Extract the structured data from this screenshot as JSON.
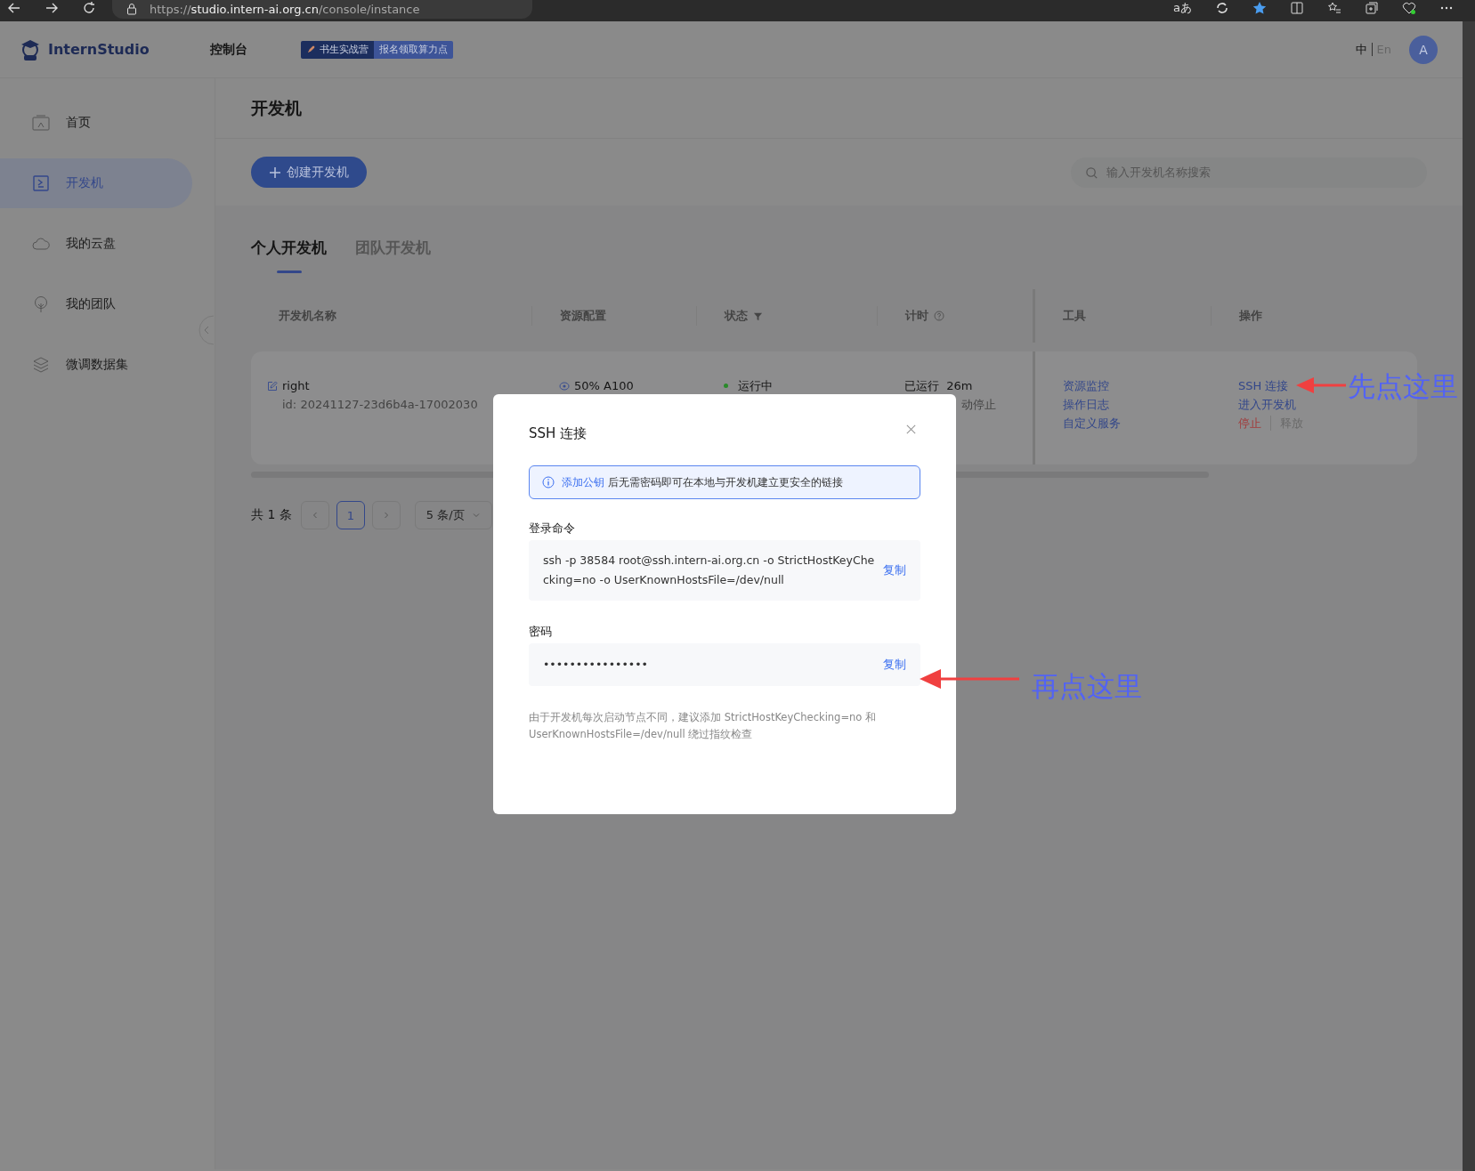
{
  "browser": {
    "url": {
      "scheme": "https://",
      "host": "studio.intern-ai.org.cn",
      "path": "/console/instance"
    },
    "read_aloud": "aあ"
  },
  "header": {
    "logo": "InternStudio",
    "console": "控制台",
    "banner": {
      "tag": "书生实战营",
      "text": "报名领取算力点"
    },
    "languages": [
      {
        "label": "中",
        "selected": true
      },
      {
        "label": "En",
        "selected": false
      }
    ],
    "avatar": "A"
  },
  "sidebar": {
    "items": [
      {
        "label": "首页",
        "selected": false
      },
      {
        "label": "开发机",
        "selected": true
      },
      {
        "label": "我的云盘",
        "selected": false
      },
      {
        "label": "我的团队",
        "selected": false
      },
      {
        "label": "微调数据集",
        "selected": false
      }
    ]
  },
  "page": {
    "title": "开发机",
    "create_button": "创建开发机",
    "search": {
      "placeholder": "输入开发机名称搜索"
    },
    "tabs": [
      {
        "label": "个人开发机",
        "selected": true
      },
      {
        "label": "团队开发机",
        "selected": false
      }
    ],
    "table": {
      "columns": [
        {
          "label": "开发机名称",
          "kind": "plain"
        },
        {
          "label": "资源配置",
          "kind": "plain"
        },
        {
          "label": "状态",
          "kind": "filter"
        },
        {
          "label": "计时",
          "kind": "help"
        },
        {
          "label": "工具",
          "kind": "plain"
        },
        {
          "label": "操作",
          "kind": "plain"
        }
      ],
      "rows": [
        {
          "name": "right",
          "id": "id: 20241127-23d6b4a-17002030",
          "resource": "50% A100",
          "status": "运行中",
          "timer": "已运行  26m",
          "timer_note": "动停止",
          "tools": [
            "资源监控",
            "操作日志",
            "自定义服务"
          ],
          "action_lines": [
            [
              {
                "label": "SSH 连接",
                "kind": "link"
              }
            ],
            [
              {
                "label": "进入开发机",
                "kind": "link"
              }
            ],
            [
              {
                "label": "停止",
                "kind": "danger"
              },
              {
                "label": "释放",
                "kind": "disabled"
              }
            ]
          ]
        }
      ]
    },
    "pagination": {
      "total": "共 1 条",
      "pages": [
        {
          "label": "1",
          "selected": true
        }
      ],
      "page_size": "5 条/页"
    }
  },
  "modal": {
    "title": "SSH 连接",
    "alert": {
      "link": "添加公钥",
      "text": "后无需密码即可在本地与开发机建立更安全的链接"
    },
    "fields": [
      {
        "label": "登录命令",
        "value": "ssh -p 38584 root@ssh.intern-ai.org.cn -o StrictHostKeyChecking=no -o UserKnownHostsFile=/dev/null",
        "copy": "复制"
      },
      {
        "label": "密码",
        "value": "••••••••••••••••",
        "copy": "复制"
      }
    ],
    "note": "由于开发机每次启动节点不同，建议添加 StrictHostKeyChecking=no 和 UserKnownHostsFile=/dev/null 绕过指纹检查"
  },
  "annotations": [
    {
      "text": "先点这里"
    },
    {
      "text": "再点这里"
    }
  ]
}
